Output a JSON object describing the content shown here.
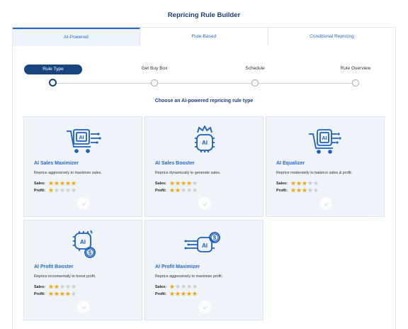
{
  "page": {
    "title": "Repricing Rule Builder"
  },
  "tabs": [
    {
      "label": "AI-Powered",
      "active": true
    },
    {
      "label": "Rule-Based",
      "active": false
    },
    {
      "label": "Conditional Repricing",
      "active": false
    }
  ],
  "steps": [
    {
      "label": "Rule Type",
      "active": true
    },
    {
      "label": "Get Buy Box",
      "active": false
    },
    {
      "label": "Schedule",
      "active": false
    },
    {
      "label": "Rule Overview",
      "active": false
    }
  ],
  "subtitle": "Choose an AI-powered repricing rule type",
  "labels": {
    "sales": "Sales:",
    "profit": "Profit:"
  },
  "colors": {
    "accent": "#2a67c4",
    "navy": "#16457f",
    "star_on": "#f3a712",
    "star_off": "#c9ccd1",
    "card_bg": "#eef4fa"
  },
  "cards": [
    {
      "name": "AI Sales Maximizer",
      "description": "Reprice aggressively to maximize sales.",
      "sales_rating": 5,
      "profit_rating": 1,
      "icon": "ai-cart-icon"
    },
    {
      "name": "AI Sales Booster",
      "description": "Reprice dynamically to generate sales.",
      "sales_rating": 4,
      "profit_rating": 2,
      "icon": "ai-crown-chip-icon"
    },
    {
      "name": "AI Equalizer",
      "description": "Reprice moderately to balance sales & profit.",
      "sales_rating": 3,
      "profit_rating": 3,
      "icon": "ai-cart-icon"
    },
    {
      "name": "AI Profit Booster",
      "description": "Reprice incrementally to boost profit.",
      "sales_rating": 2,
      "profit_rating": 4,
      "icon": "ai-dollar-chip-icon"
    },
    {
      "name": "AI Profit Maximizer",
      "description": "Reprice aggressively to maximize profit.",
      "sales_rating": 1,
      "profit_rating": 5,
      "icon": "ai-dollar-chip-icon"
    }
  ]
}
